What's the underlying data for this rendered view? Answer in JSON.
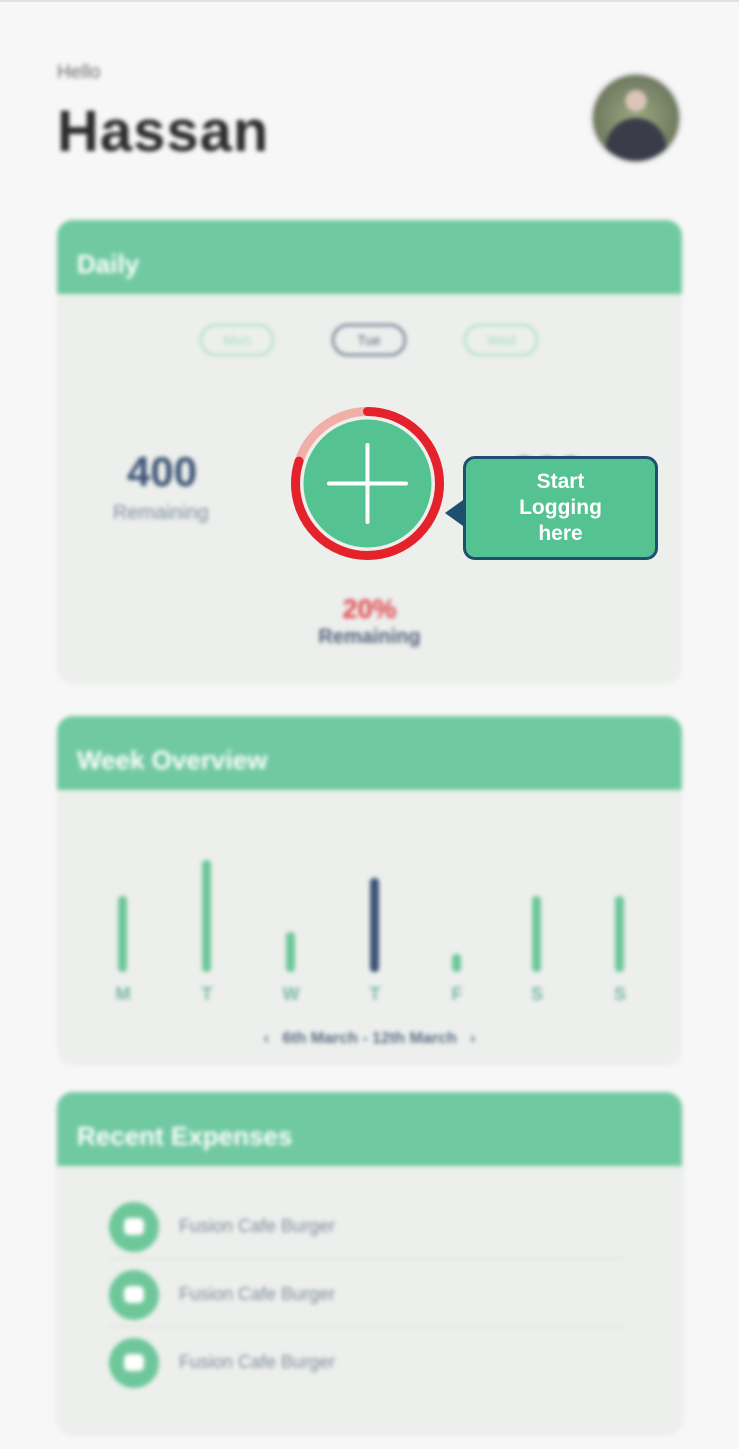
{
  "greeting": {
    "hello": "Hello",
    "name": "Hassan"
  },
  "daily": {
    "title": "Daily",
    "days": [
      "Mon",
      "Tue",
      "Wed"
    ],
    "selected_day": "Tue",
    "remaining_value": "400",
    "remaining_label": "Remaining",
    "right_value_hidden": "200",
    "percent": "20%",
    "percent_label": "Remaining",
    "progress_fraction": 0.8
  },
  "tooltip": {
    "text": "Start Logging here"
  },
  "week": {
    "title": "Week Overview",
    "days": [
      "M",
      "T",
      "W",
      "T",
      "F",
      "S",
      "S"
    ],
    "levels": [
      0.68,
      1.0,
      0.36,
      0.84,
      0.16,
      0.68,
      0.68
    ],
    "active_index": 3,
    "range": "6th March - 12th March",
    "prev_icon": "chevron-left-icon",
    "next_icon": "chevron-right-icon"
  },
  "expenses": {
    "title": "Recent Expenses",
    "items": [
      {
        "label": "Fusion Cafe Burger",
        "icon": "wallet-icon"
      },
      {
        "label": "Fusion Cafe Burger",
        "icon": "wallet-icon"
      },
      {
        "label": "Fusion Cafe Burger",
        "icon": "wallet-icon"
      }
    ]
  },
  "colors": {
    "accent": "#71c9a2",
    "fab": "#55c291",
    "ring": "#e4222b",
    "ring_track": "#f0b0a8",
    "tooltip_border": "#1f4f70"
  }
}
